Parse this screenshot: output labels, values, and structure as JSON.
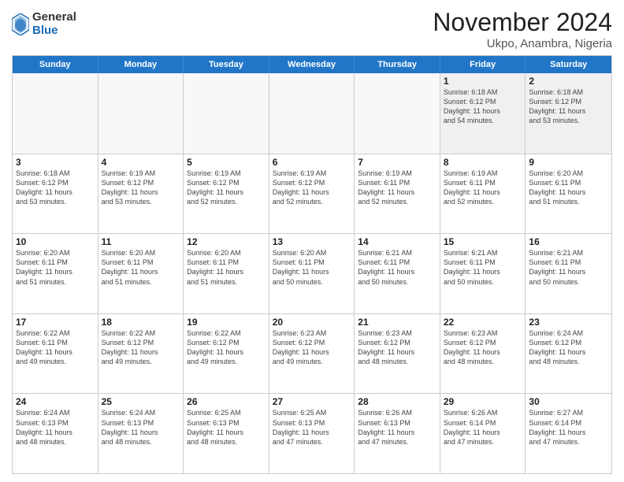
{
  "logo": {
    "general": "General",
    "blue": "Blue"
  },
  "title": "November 2024",
  "location": "Ukpo, Anambra, Nigeria",
  "days_header": [
    "Sunday",
    "Monday",
    "Tuesday",
    "Wednesday",
    "Thursday",
    "Friday",
    "Saturday"
  ],
  "weeks": [
    [
      {
        "day": "",
        "empty": true
      },
      {
        "day": "",
        "empty": true
      },
      {
        "day": "",
        "empty": true
      },
      {
        "day": "",
        "empty": true
      },
      {
        "day": "",
        "empty": true
      },
      {
        "day": "1",
        "detail": "Sunrise: 6:18 AM\nSunset: 6:12 PM\nDaylight: 11 hours\nand 54 minutes."
      },
      {
        "day": "2",
        "detail": "Sunrise: 6:18 AM\nSunset: 6:12 PM\nDaylight: 11 hours\nand 53 minutes."
      }
    ],
    [
      {
        "day": "3",
        "detail": "Sunrise: 6:18 AM\nSunset: 6:12 PM\nDaylight: 11 hours\nand 53 minutes."
      },
      {
        "day": "4",
        "detail": "Sunrise: 6:19 AM\nSunset: 6:12 PM\nDaylight: 11 hours\nand 53 minutes."
      },
      {
        "day": "5",
        "detail": "Sunrise: 6:19 AM\nSunset: 6:12 PM\nDaylight: 11 hours\nand 52 minutes."
      },
      {
        "day": "6",
        "detail": "Sunrise: 6:19 AM\nSunset: 6:12 PM\nDaylight: 11 hours\nand 52 minutes."
      },
      {
        "day": "7",
        "detail": "Sunrise: 6:19 AM\nSunset: 6:11 PM\nDaylight: 11 hours\nand 52 minutes."
      },
      {
        "day": "8",
        "detail": "Sunrise: 6:19 AM\nSunset: 6:11 PM\nDaylight: 11 hours\nand 52 minutes."
      },
      {
        "day": "9",
        "detail": "Sunrise: 6:20 AM\nSunset: 6:11 PM\nDaylight: 11 hours\nand 51 minutes."
      }
    ],
    [
      {
        "day": "10",
        "detail": "Sunrise: 6:20 AM\nSunset: 6:11 PM\nDaylight: 11 hours\nand 51 minutes."
      },
      {
        "day": "11",
        "detail": "Sunrise: 6:20 AM\nSunset: 6:11 PM\nDaylight: 11 hours\nand 51 minutes."
      },
      {
        "day": "12",
        "detail": "Sunrise: 6:20 AM\nSunset: 6:11 PM\nDaylight: 11 hours\nand 51 minutes."
      },
      {
        "day": "13",
        "detail": "Sunrise: 6:20 AM\nSunset: 6:11 PM\nDaylight: 11 hours\nand 50 minutes."
      },
      {
        "day": "14",
        "detail": "Sunrise: 6:21 AM\nSunset: 6:11 PM\nDaylight: 11 hours\nand 50 minutes."
      },
      {
        "day": "15",
        "detail": "Sunrise: 6:21 AM\nSunset: 6:11 PM\nDaylight: 11 hours\nand 50 minutes."
      },
      {
        "day": "16",
        "detail": "Sunrise: 6:21 AM\nSunset: 6:11 PM\nDaylight: 11 hours\nand 50 minutes."
      }
    ],
    [
      {
        "day": "17",
        "detail": "Sunrise: 6:22 AM\nSunset: 6:11 PM\nDaylight: 11 hours\nand 49 minutes."
      },
      {
        "day": "18",
        "detail": "Sunrise: 6:22 AM\nSunset: 6:12 PM\nDaylight: 11 hours\nand 49 minutes."
      },
      {
        "day": "19",
        "detail": "Sunrise: 6:22 AM\nSunset: 6:12 PM\nDaylight: 11 hours\nand 49 minutes."
      },
      {
        "day": "20",
        "detail": "Sunrise: 6:23 AM\nSunset: 6:12 PM\nDaylight: 11 hours\nand 49 minutes."
      },
      {
        "day": "21",
        "detail": "Sunrise: 6:23 AM\nSunset: 6:12 PM\nDaylight: 11 hours\nand 48 minutes."
      },
      {
        "day": "22",
        "detail": "Sunrise: 6:23 AM\nSunset: 6:12 PM\nDaylight: 11 hours\nand 48 minutes."
      },
      {
        "day": "23",
        "detail": "Sunrise: 6:24 AM\nSunset: 6:12 PM\nDaylight: 11 hours\nand 48 minutes."
      }
    ],
    [
      {
        "day": "24",
        "detail": "Sunrise: 6:24 AM\nSunset: 6:13 PM\nDaylight: 11 hours\nand 48 minutes."
      },
      {
        "day": "25",
        "detail": "Sunrise: 6:24 AM\nSunset: 6:13 PM\nDaylight: 11 hours\nand 48 minutes."
      },
      {
        "day": "26",
        "detail": "Sunrise: 6:25 AM\nSunset: 6:13 PM\nDaylight: 11 hours\nand 48 minutes."
      },
      {
        "day": "27",
        "detail": "Sunrise: 6:25 AM\nSunset: 6:13 PM\nDaylight: 11 hours\nand 47 minutes."
      },
      {
        "day": "28",
        "detail": "Sunrise: 6:26 AM\nSunset: 6:13 PM\nDaylight: 11 hours\nand 47 minutes."
      },
      {
        "day": "29",
        "detail": "Sunrise: 6:26 AM\nSunset: 6:14 PM\nDaylight: 11 hours\nand 47 minutes."
      },
      {
        "day": "30",
        "detail": "Sunrise: 6:27 AM\nSunset: 6:14 PM\nDaylight: 11 hours\nand 47 minutes."
      }
    ]
  ]
}
